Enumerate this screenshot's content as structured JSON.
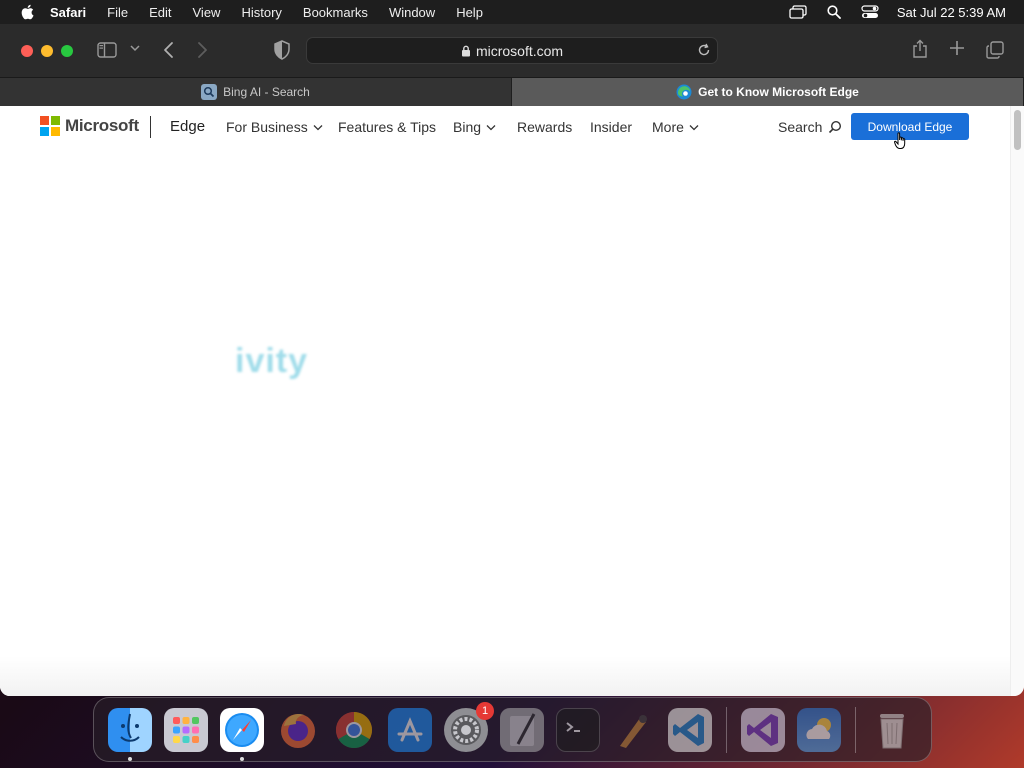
{
  "menubar": {
    "app_name": "Safari",
    "items": [
      "File",
      "Edit",
      "View",
      "History",
      "Bookmarks",
      "Window",
      "Help"
    ],
    "clock": "Sat Jul 22  5:39 AM"
  },
  "browser": {
    "address": "microsoft.com",
    "tabs": [
      {
        "title": "Bing AI - Search",
        "icon": "bing-search-icon",
        "active": false
      },
      {
        "title": "Get to Know Microsoft Edge",
        "icon": "edge-icon",
        "active": true
      }
    ]
  },
  "page": {
    "brand": "Microsoft",
    "product": "Edge",
    "nav": [
      {
        "label": "For Business",
        "has_dropdown": true
      },
      {
        "label": "Features & Tips",
        "has_dropdown": false
      },
      {
        "label": "Bing",
        "has_dropdown": true
      },
      {
        "label": "Rewards",
        "has_dropdown": false
      },
      {
        "label": "Insider",
        "has_dropdown": false
      },
      {
        "label": "More",
        "has_dropdown": true
      }
    ],
    "search_label": "Search",
    "download_label": "Download Edge",
    "hero_fragment": "ivity",
    "colors": {
      "download_button": "#1a6fd8",
      "hero_text": "#8fd6e6"
    }
  },
  "dock": {
    "apps": [
      {
        "name": "Finder",
        "running": true
      },
      {
        "name": "Launchpad",
        "running": false
      },
      {
        "name": "Safari",
        "running": true
      },
      {
        "name": "Firefox",
        "running": false
      },
      {
        "name": "Chrome",
        "running": false
      },
      {
        "name": "App Store",
        "running": false
      },
      {
        "name": "System Settings",
        "running": false,
        "badge": "1"
      },
      {
        "name": "Script Editor",
        "running": false
      },
      {
        "name": "Terminal",
        "running": false
      },
      {
        "name": "Instruments",
        "running": false
      },
      {
        "name": "Visual Studio Code",
        "running": false
      },
      {
        "name": "Visual Studio",
        "running": false
      },
      {
        "name": "Weather",
        "running": false
      },
      {
        "name": "Trash",
        "running": false
      }
    ]
  }
}
